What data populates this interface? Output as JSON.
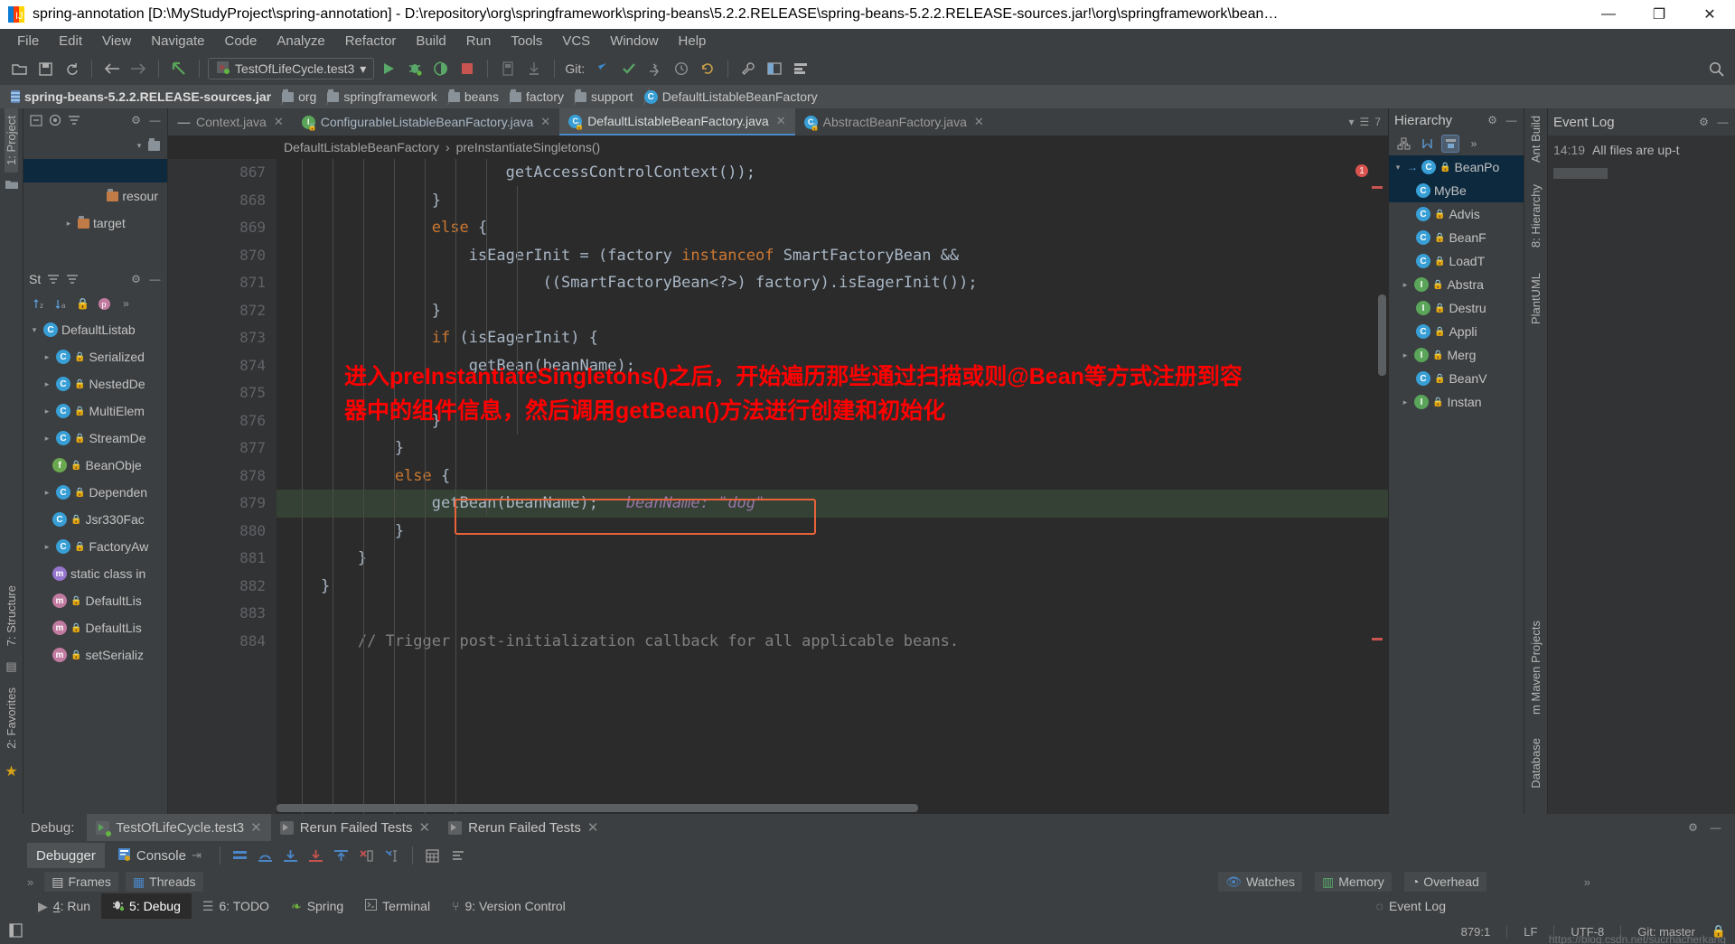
{
  "window": {
    "title": "spring-annotation [D:\\MyStudyProject\\spring-annotation] - D:\\repository\\org\\springframework\\spring-beans\\5.2.2.RELEASE\\spring-beans-5.2.2.RELEASE-sources.jar!\\org\\springframework\\bean…",
    "minimize": "—",
    "maximize": "❐",
    "close": "✕"
  },
  "menubar": [
    {
      "label": "File"
    },
    {
      "label": "Edit"
    },
    {
      "label": "View"
    },
    {
      "label": "Navigate"
    },
    {
      "label": "Code"
    },
    {
      "label": "Analyze"
    },
    {
      "label": "Refactor"
    },
    {
      "label": "Build"
    },
    {
      "label": "Run"
    },
    {
      "label": "Tools"
    },
    {
      "label": "VCS"
    },
    {
      "label": "Window"
    },
    {
      "label": "Help"
    }
  ],
  "toolbar": {
    "open": "📂",
    "save": "💾",
    "sync": "⟳",
    "back": "←",
    "forward": "→",
    "revert": "↰",
    "run_config": "TestOfLifeCycle.test3",
    "run_config_caret": "▾",
    "run": "▶",
    "debug": "🐞",
    "coverage": "◑",
    "stop": "■",
    "build": "▤",
    "build2": "⤓",
    "git_label": "Git:",
    "git_update": "↙",
    "git_commit": "✓",
    "git_push": "⇥",
    "git_history": "🕘",
    "git_revert": "↺",
    "settings": "🔧",
    "structure": "▥",
    "layout": "▤",
    "search": "🔍"
  },
  "breadcrumb": [
    {
      "label": "spring-beans-5.2.2.RELEASE-sources.jar",
      "icon": "jar-icon",
      "bold": true
    },
    {
      "label": "org",
      "icon": "folder-icon"
    },
    {
      "label": "springframework",
      "icon": "folder-icon"
    },
    {
      "label": "beans",
      "icon": "folder-icon"
    },
    {
      "label": "factory",
      "icon": "folder-icon"
    },
    {
      "label": "support",
      "icon": "folder-icon"
    },
    {
      "label": "DefaultListableBeanFactory",
      "icon": "class-icon"
    }
  ],
  "left_rail": {
    "project": "1: Project",
    "structure": "7: Structure",
    "favorites": "2: Favorites",
    "star": "★"
  },
  "project_panel": {
    "header_icons": [
      "collapse-icon",
      "target-icon",
      "locate-icon",
      "gear-icon",
      "minimize-icon"
    ],
    "items": [
      {
        "label": "",
        "arrow": "▾",
        "indent": 0
      },
      {
        "label": "resour",
        "indent": 1,
        "icon": "resource-folder-icon"
      },
      {
        "label": "target",
        "arrow": "▸",
        "indent": 1,
        "icon": "target-folder-icon"
      }
    ]
  },
  "structure_panel": {
    "title": "St",
    "header_icons": [
      "sort-icon",
      "collapse-icon",
      "gear-icon",
      "minimize-icon"
    ],
    "sort_icons": [
      "sort-alpha-icon",
      "sort-visibility-icon",
      "show-inherited-icon",
      "show-properties-icon",
      "more-icon"
    ],
    "items": [
      {
        "label": "DefaultListab",
        "arrow": "▾",
        "icon": "class-icon",
        "indent": 0,
        "selected": true
      },
      {
        "label": "Serialized",
        "arrow": "▸",
        "icon": "class-icon",
        "lock": true,
        "indent": 1
      },
      {
        "label": "NestedDe",
        "arrow": "▸",
        "icon": "class-icon",
        "lock": true,
        "indent": 1
      },
      {
        "label": "MultiElem",
        "arrow": "▸",
        "icon": "class-icon",
        "lock": true,
        "indent": 1
      },
      {
        "label": "StreamDe",
        "arrow": "▸",
        "icon": "class-icon",
        "lock": true,
        "indent": 1
      },
      {
        "label": "BeanObje",
        "arrow": "",
        "icon": "field-icon",
        "lock": true,
        "indent": 1
      },
      {
        "label": "Dependen",
        "arrow": "▸",
        "icon": "class-icon",
        "lock": true,
        "indent": 1
      },
      {
        "label": "Jsr330Fac",
        "arrow": "",
        "icon": "class-icon",
        "lock": true,
        "indent": 1
      },
      {
        "label": "FactoryAw",
        "arrow": "▸",
        "icon": "class-icon",
        "lock": true,
        "indent": 1
      },
      {
        "label": "static class in",
        "arrow": "",
        "icon": "method-icon",
        "indent": 1
      },
      {
        "label": "DefaultLis",
        "arrow": "",
        "icon": "method-icon",
        "lock": true,
        "indent": 1
      },
      {
        "label": "DefaultLis",
        "arrow": "",
        "icon": "method-icon",
        "lock": true,
        "indent": 1
      },
      {
        "label": "setSerializ",
        "arrow": "",
        "icon": "method-icon",
        "lock": true,
        "indent": 1
      }
    ]
  },
  "editor": {
    "tabs": [
      {
        "label": "Context.java",
        "icon": "dash-icon",
        "active": false,
        "close": "✕"
      },
      {
        "label": "ConfigurableListableBeanFactory.java",
        "icon": "interface-icon",
        "active": false,
        "close": "✕"
      },
      {
        "label": "DefaultListableBeanFactory.java",
        "icon": "class-icon",
        "active": true,
        "close": "✕"
      },
      {
        "label": "AbstractBeanFactory.java",
        "icon": "class-icon",
        "active": false,
        "close": "✕"
      }
    ],
    "tabs_right": {
      "collapse": "▾",
      "count": "7"
    },
    "nav_breadcrumb": [
      "DefaultListableBeanFactory",
      "preInstantiateSingletons()"
    ],
    "nav_separator": "›",
    "first_line_number": 867,
    "lines": [
      {
        "num": "867",
        "text": "                        getAccessControlContext());"
      },
      {
        "num": "868",
        "text": "                }"
      },
      {
        "num": "869",
        "text": "                else {"
      },
      {
        "num": "870",
        "text": "                    isEagerInit = (factory instanceof SmartFactoryBean &&"
      },
      {
        "num": "871",
        "text": "                            ((SmartFactoryBean<?>) factory).isEagerInit());"
      },
      {
        "num": "872",
        "text": "                }"
      },
      {
        "num": "873",
        "text": "                if (isEagerInit) {"
      },
      {
        "num": "874",
        "text": "                    getBean(beanName);"
      },
      {
        "num": "875",
        "text": ""
      },
      {
        "num": "876",
        "text": "                }"
      },
      {
        "num": "877",
        "text": "            }"
      },
      {
        "num": "878",
        "text": "            else {"
      },
      {
        "num": "879",
        "text": "                getBean(beanName);"
      },
      {
        "num": "880",
        "text": "            }"
      },
      {
        "num": "881",
        "text": "        }"
      },
      {
        "num": "882",
        "text": "    }"
      },
      {
        "num": "883",
        "text": ""
      },
      {
        "num": "884",
        "text": "        // Trigger post-initialization callback for all applicable beans."
      }
    ],
    "highlighted_line": "879",
    "debug_inline": {
      "code": "getBean(beanName);",
      "hint": "beanName:",
      "value": "\"dog\""
    },
    "annotation": "进入preInstantiateSingletons()之后，开始遍历那些通过扫描或则@Bean等方式注册到容器中的组件信息，然后调用getBean()方法进行创建和初始化"
  },
  "hierarchy": {
    "title": "Hierarchy",
    "gear": "⚙",
    "minimize": "—",
    "tools": [
      "class-hierarchy-icon",
      "subtypes-icon",
      "supertypes-icon",
      "more-icon"
    ],
    "rows": [
      {
        "label": "BeanPo",
        "arrow": "▾",
        "icon": "class-icon",
        "indent": 0,
        "selected": true
      },
      {
        "label": "MyBe",
        "arrow": "",
        "icon": "class-icon",
        "indent": 1,
        "selected": true
      },
      {
        "label": "Advis",
        "arrow": "",
        "icon": "class-icon",
        "indent": 1
      },
      {
        "label": "BeanF",
        "arrow": "",
        "icon": "class-icon",
        "indent": 1
      },
      {
        "label": "LoadT",
        "arrow": "",
        "icon": "class-icon",
        "indent": 1
      },
      {
        "label": "Abstra",
        "arrow": "▸",
        "icon": "interface-icon",
        "indent": 1
      },
      {
        "label": "Destru",
        "arrow": "",
        "icon": "interface-icon",
        "indent": 1
      },
      {
        "label": "Appli",
        "arrow": "",
        "icon": "class-icon",
        "indent": 1
      },
      {
        "label": "Merg",
        "arrow": "▸",
        "icon": "interface-icon",
        "indent": 1
      },
      {
        "label": "BeanV",
        "arrow": "",
        "icon": "class-icon",
        "indent": 1
      },
      {
        "label": "Instan",
        "arrow": "▸",
        "icon": "interface-icon",
        "indent": 1
      }
    ]
  },
  "right_rail": [
    "Ant Build",
    "8: Hierarchy",
    "PlantUML",
    "m Maven Projects",
    "Database"
  ],
  "event_log": {
    "title": "Event Log",
    "gear": "⚙",
    "minimize": "—",
    "entries": [
      {
        "time": "14:19",
        "text": "All files are up-t"
      }
    ]
  },
  "debug_panel": {
    "label": "Debug:",
    "tabs": [
      {
        "label": "TestOfLifeCycle.test3",
        "active": true,
        "close": "✕"
      },
      {
        "label": "Rerun Failed Tests",
        "active": false,
        "close": "✕"
      },
      {
        "label": "Rerun Failed Tests",
        "active": false,
        "close": "✕"
      }
    ],
    "settings": "⚙",
    "minimize": "—",
    "subtabs": [
      {
        "label": "Debugger",
        "active": true
      },
      {
        "label": "Console",
        "active": false
      }
    ],
    "console_pin": "⇥",
    "tools": [
      "show-execution-point-icon",
      "step-over-icon",
      "step-into-icon",
      "force-step-into-icon",
      "step-out-icon",
      "drop-frame-icon",
      "run-to-cursor-icon",
      "evaluate-icon",
      "layout-icon"
    ],
    "frames_tab": "Frames",
    "threads_tab": "Threads",
    "mini_tabs": [
      "Watches",
      "Memory",
      "Overhead"
    ],
    "expand": "»"
  },
  "statusbar": {
    "items": [
      {
        "label": "4: Run",
        "icon": "run-icon",
        "active": false,
        "mnemonic": "4"
      },
      {
        "label": "5: Debug",
        "icon": "debug-icon",
        "active": true,
        "mnemonic": "5"
      },
      {
        "label": "6: TODO",
        "icon": "todo-icon",
        "active": false,
        "mnemonic": "6"
      },
      {
        "label": "Spring",
        "icon": "spring-icon",
        "active": false,
        "mnemonic": ""
      },
      {
        "label": "Terminal",
        "icon": "terminal-icon",
        "active": false,
        "mnemonic": ""
      },
      {
        "label": "9: Version Control",
        "icon": "vcs-icon",
        "active": false,
        "mnemonic": "9"
      }
    ]
  },
  "footer": {
    "toggle_icon": "toggle-sidebar-icon",
    "caret_position": "879:1",
    "line_separator": "LF",
    "encoding": "UTF-8",
    "indent": "",
    "branch": "Git: master",
    "lock_icon": "🔒",
    "watermark": "https://blog.csdn.net/sucrhacherkang"
  },
  "colors": {
    "accent_blue": "#4a88c7",
    "annotation_red": "#ff0000",
    "highlight_line": "#344134",
    "debug_box_border": "#e8633a",
    "editor_bg": "#2b2b2b",
    "panel_bg": "#3c3f41"
  }
}
